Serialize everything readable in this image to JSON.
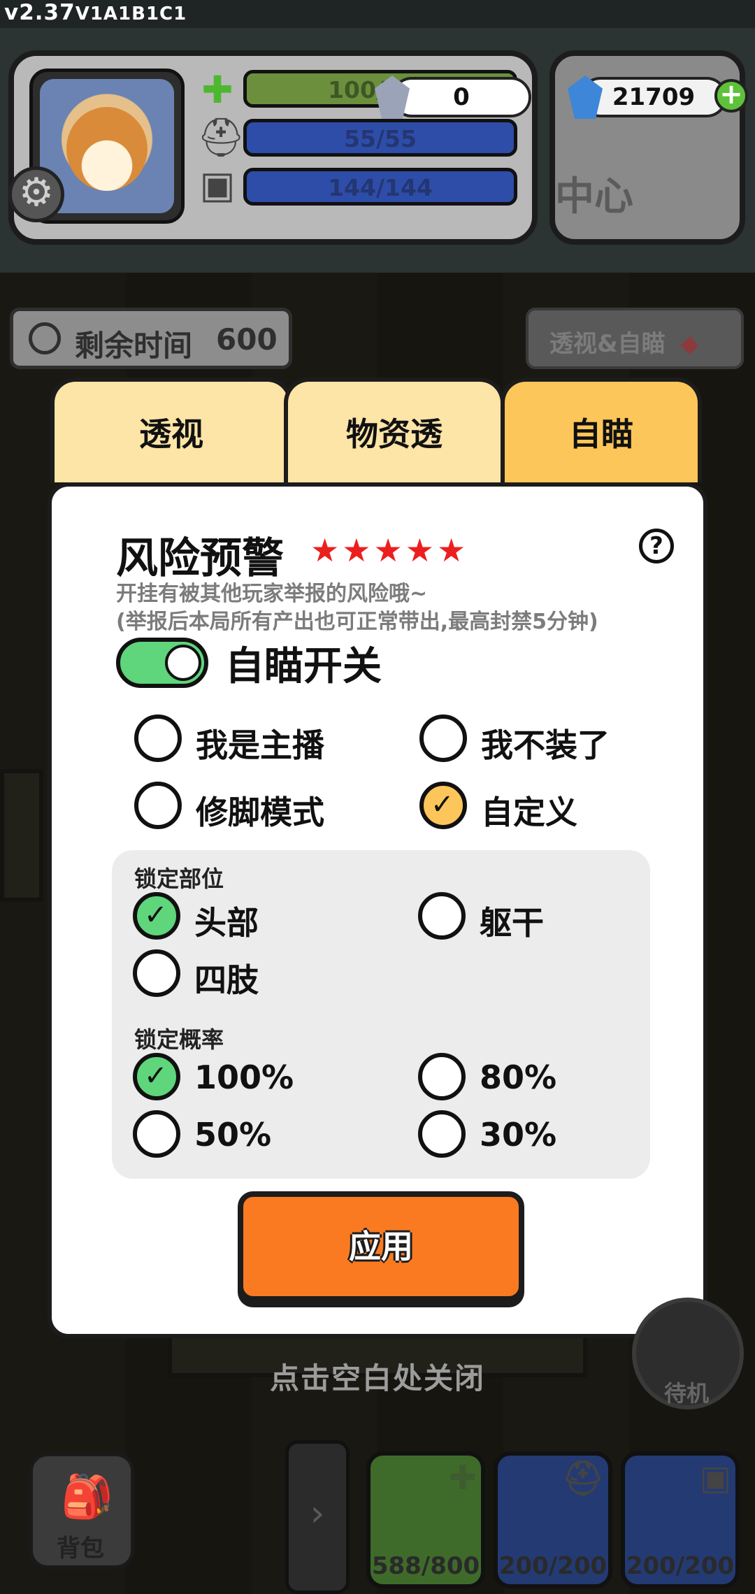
{
  "version": {
    "main": "v2.37",
    "suffix": "V1A1B1C1"
  },
  "hud": {
    "health": "100/100",
    "helmet": "55/55",
    "armor": "144/144",
    "currency_crystal": "0",
    "currency_gem": "21709",
    "map_text": "中心"
  },
  "status": {
    "timer_label": "剩余时间",
    "timer_value": "600",
    "xray_button": "透视&自瞄"
  },
  "tabs": [
    "透视",
    "物资透",
    "自瞄"
  ],
  "modal": {
    "title": "风险预警",
    "stars": "★★★★★",
    "help": "?",
    "warning_line1": "开挂有被其他玩家举报的风险哦~",
    "warning_line2": "(举报后本局所有产出也可正常带出,最高封禁5分钟)",
    "toggle_label": "自瞄开关",
    "modes": [
      "我是主播",
      "我不装了",
      "修脚模式",
      "自定义"
    ],
    "lock_part_title": "锁定部位",
    "lock_parts": [
      "头部",
      "躯干",
      "四肢"
    ],
    "lock_rate_title": "锁定概率",
    "lock_rates": [
      "100%",
      "80%",
      "50%",
      "30%"
    ],
    "apply": "应用"
  },
  "close_hint": "点击空白处关闭",
  "standby": "待机",
  "bottom": {
    "backpack": "背包",
    "arrow": "›",
    "slots": [
      "588/800",
      "200/200",
      "200/200"
    ]
  },
  "colors": {
    "toggle_on": "#5fd57c",
    "tab_active": "#fcc65a",
    "tab_inactive": "#fde4a7",
    "apply_button": "#fa7a21",
    "stars": "#ec1f1f"
  }
}
